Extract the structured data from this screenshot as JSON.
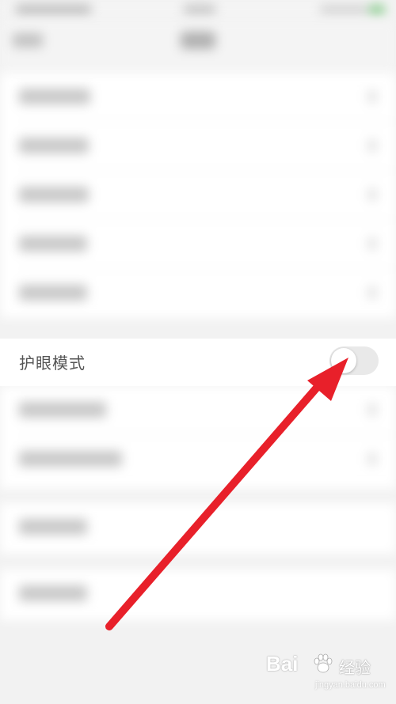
{
  "settings": {
    "eye_protection_label": "护眼模式",
    "eye_protection_enabled": false
  },
  "watermark": {
    "logo": "Bai",
    "brand": "经验",
    "sub": "jingyan.baidu.com"
  },
  "colors": {
    "arrow": "#e8202a",
    "toggle_off": "#e9e9e9",
    "page_background": "#f2f2f2"
  }
}
